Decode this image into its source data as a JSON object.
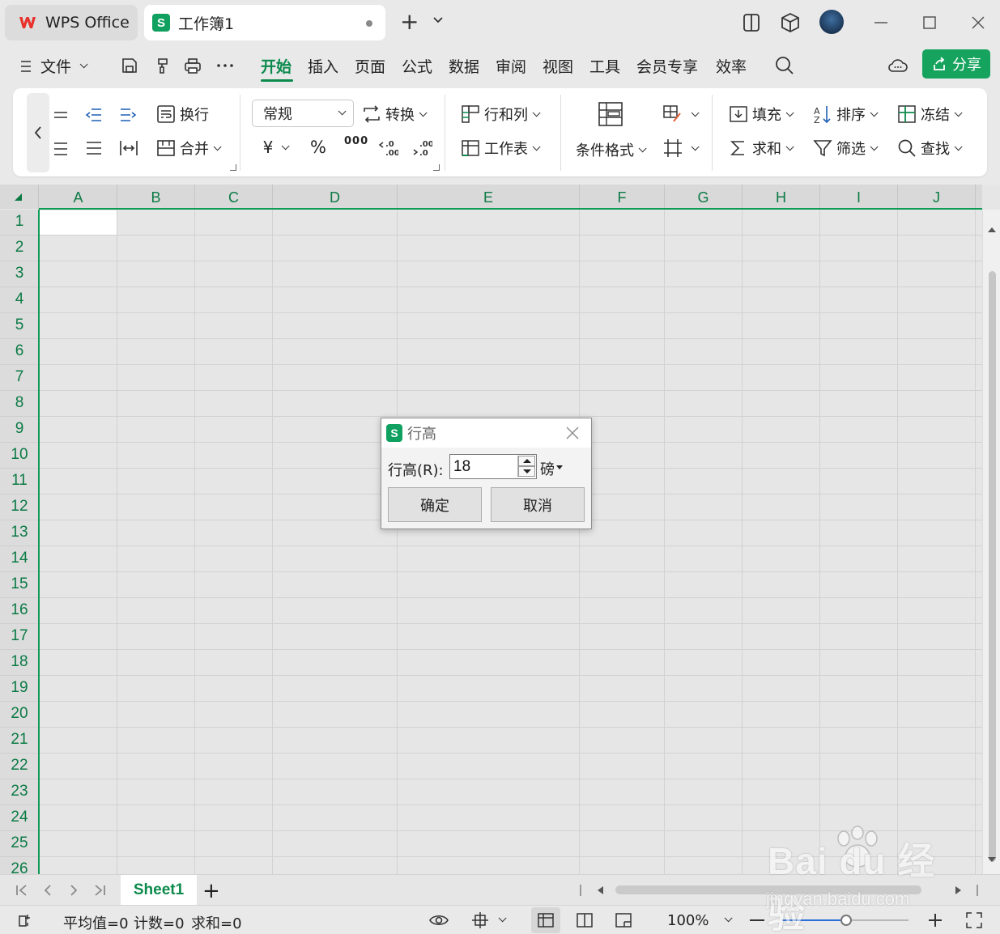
{
  "titlebar": {
    "app_tab": "WPS Office",
    "doc_tab": "工作簿1",
    "new_tab_symbol": "+"
  },
  "menu": {
    "file": "文件",
    "items": [
      "开始",
      "插入",
      "页面",
      "公式",
      "数据",
      "审阅",
      "视图",
      "工具",
      "会员专享",
      "效率"
    ],
    "active": "开始",
    "share": "分享"
  },
  "ribbon": {
    "wrap": "换行",
    "merge": "合并",
    "number_format": "常规",
    "convert": "转换",
    "currency_symbol": "¥",
    "percent_symbol": "%",
    "thousands_symbol": "000",
    "rows_cols": "行和列",
    "worksheet": "工作表",
    "conditional_format": "条件格式",
    "fill": "填充",
    "sum": "求和",
    "sort": "排序",
    "filter": "筛选",
    "freeze": "冻结",
    "find": "查找"
  },
  "grid": {
    "columns": [
      "A",
      "B",
      "C",
      "D",
      "E",
      "F",
      "G",
      "H",
      "I",
      "J"
    ],
    "rows": [
      "1",
      "2",
      "3",
      "4",
      "5",
      "6",
      "7",
      "8",
      "9",
      "10",
      "11",
      "12",
      "13",
      "14",
      "15",
      "16",
      "17",
      "18",
      "19",
      "20",
      "21",
      "22",
      "23",
      "24",
      "25",
      "26"
    ],
    "active_cell": "A1"
  },
  "sheet_tabs": {
    "tabs": [
      "Sheet1"
    ],
    "add_symbol": "+"
  },
  "status": {
    "average": "平均值=0",
    "count": "计数=0",
    "sum": "求和=0",
    "zoom": "100%",
    "zoom_level_fraction": 0.5
  },
  "dialog": {
    "title": "行高",
    "label": "行高(R):",
    "value": "18",
    "unit": "磅",
    "ok": "确定",
    "cancel": "取消"
  },
  "watermark": {
    "brand": "Bai du 经验",
    "url": "jingyan.baidu.com"
  },
  "colors": {
    "accent": "#0b8a4c",
    "share_button": "#15a35e",
    "header_text": "#0b7a45",
    "selection_border": "#0f9b55"
  }
}
